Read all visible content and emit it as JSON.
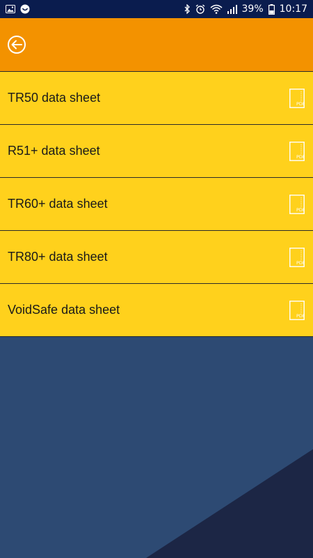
{
  "status_bar": {
    "battery": "39%",
    "time": "10:17",
    "icons": [
      "image-icon",
      "notification-icon",
      "bluetooth-icon",
      "alarm-icon",
      "wifi-icon",
      "signal-icon",
      "battery-icon"
    ]
  },
  "header": {
    "back_icon": "back-arrow-icon",
    "color": "#f39200"
  },
  "items": [
    {
      "label": "TR50 data sheet",
      "icon": "pdf-icon"
    },
    {
      "label": "R51+ data sheet",
      "icon": "pdf-icon"
    },
    {
      "label": "TR60+ data sheet",
      "icon": "pdf-icon"
    },
    {
      "label": "TR80+ data sheet",
      "icon": "pdf-icon"
    },
    {
      "label": "VoidSafe data sheet",
      "icon": "pdf-icon"
    }
  ],
  "pdf_icon_text": "PDF",
  "colors": {
    "status_bar": "#0a1c4e",
    "list_item": "#ffd11c",
    "background": "#2d4a73",
    "background_dark": "#1c2645"
  }
}
